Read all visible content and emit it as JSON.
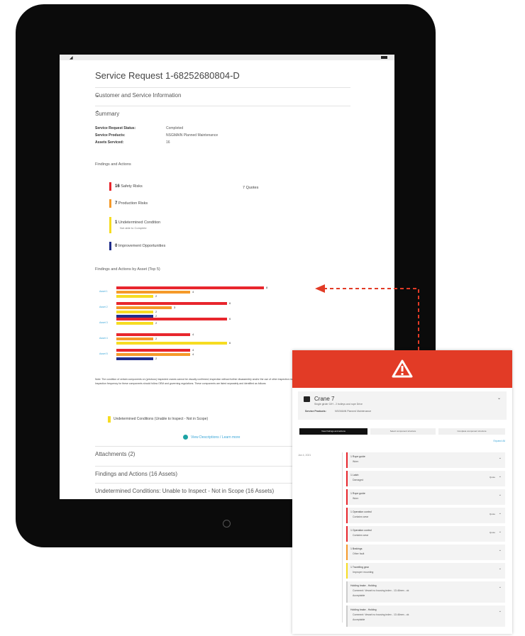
{
  "tablet": {
    "title": "Service Request 1-68252680804-D",
    "accordions": [
      {
        "label": "Customer and Service Information"
      },
      {
        "label": "Summary"
      }
    ],
    "summary": {
      "status_label": "Service Request Status:",
      "status_value": "Completed",
      "products_label": "Service Products:",
      "products_value": "NSGMAIN Planned Maintenance",
      "assets_label": "Assets Serviced:",
      "assets_value": "16"
    },
    "findings_title": "Findings and Actions",
    "findings": [
      {
        "count": "16",
        "label": "Safety Risks",
        "color": "#e8262d"
      },
      {
        "count": "7",
        "label": "Production Risks",
        "color": "#f59a2a"
      },
      {
        "count": "1",
        "label": "Undetermined Condition",
        "sub": "Not able to Complete",
        "color": "#f6dc22"
      },
      {
        "count": "0",
        "label": "Improvement Opportunities",
        "color": "#202d8b"
      }
    ],
    "quotes": "7 Quotes",
    "chart_title": "Findings and Actions by Asset (Top 5)",
    "note": "Note: The condition of certain components on (previous) inspected cranes cannot be visually confirmed; inspection without further disassembly and/or the use of other inspection methods. These components are beyond the scope of this service. Inspection frequency for these components should follow OEM and governing regulations. These components are listed separately and identified as follows:",
    "legend": "Undetermined Conditions (Unable to Inspect - Not in Scope)",
    "learn_more": "View Descriptions / Learn more",
    "bottom": [
      "Attachments (2)",
      "Findings and Actions (16 Assets)",
      "Undetermined Conditions: Unable to Inspect - Not in Scope (16 Assets)"
    ]
  },
  "chart_data": {
    "type": "bar",
    "title": "Findings and Actions by Asset (Top 5)",
    "categories": [
      "Asset 1",
      "Asset 2",
      "Asset 3",
      "Asset 4",
      "Asset 5"
    ],
    "series": [
      {
        "name": "Safety Risks",
        "color": "#e8262d",
        "values": [
          8,
          6,
          6,
          4,
          4
        ]
      },
      {
        "name": "Production Risks",
        "color": "#f59a2a",
        "values": [
          4,
          3,
          0,
          2,
          4
        ]
      },
      {
        "name": "Undetermined Condition",
        "color": "#f6dc22",
        "values": [
          2,
          2,
          2,
          6,
          0
        ]
      },
      {
        "name": "Improvement Opportunities",
        "color": "#202d8b",
        "values": [
          0,
          2,
          0,
          0,
          2
        ]
      }
    ]
  },
  "mobile": {
    "crane_title": "Crane 7",
    "crane_sub": "Single girder O/H - 2 trolleys and rope Drive",
    "products_label": "Service Products:",
    "products_value": "NSGMAIN Planned Maintenance",
    "tabs": [
      "View findings and actions",
      "Select component structure",
      "Complete component structure"
    ],
    "expand": "Expand All",
    "date": "Jan 4, 2021",
    "items": [
      {
        "num": "1",
        "title": "Rope guide",
        "status": "Worn",
        "color": "#e8262d",
        "quote": ""
      },
      {
        "num": "1",
        "title": "Latch",
        "status": "Damaged",
        "color": "#e8262d",
        "quote": "Quote"
      },
      {
        "num": "1",
        "title": "Rope guide",
        "status": "Worn",
        "color": "#e8262d",
        "quote": ""
      },
      {
        "num": "1",
        "title": "Operation control",
        "status": "Contains wear",
        "color": "#e8262d",
        "quote": "Quote"
      },
      {
        "num": "1",
        "title": "Operation control",
        "status": "Contains wear",
        "color": "#e8262d",
        "quote": "Quote"
      },
      {
        "num": "1",
        "title": "Brakings",
        "status": "Other fault",
        "color": "#f59a2a",
        "quote": ""
      },
      {
        "num": "1",
        "title": "Travelling gear",
        "status": "Improper mounting",
        "color": "#f6dc22",
        "quote": ""
      },
      {
        "num": "",
        "title": "Holding brake - Holding",
        "status": "Comment: Vessel no housing index - 13.46mm - ok",
        "extra": "Acceptable",
        "color": "#cccccc",
        "quote": ""
      },
      {
        "num": "",
        "title": "Holding brake - Holding",
        "status": "Comment: Vessel no housing index - 13.46mm - ok",
        "extra": "Acceptable",
        "color": "#cccccc",
        "quote": ""
      }
    ]
  }
}
